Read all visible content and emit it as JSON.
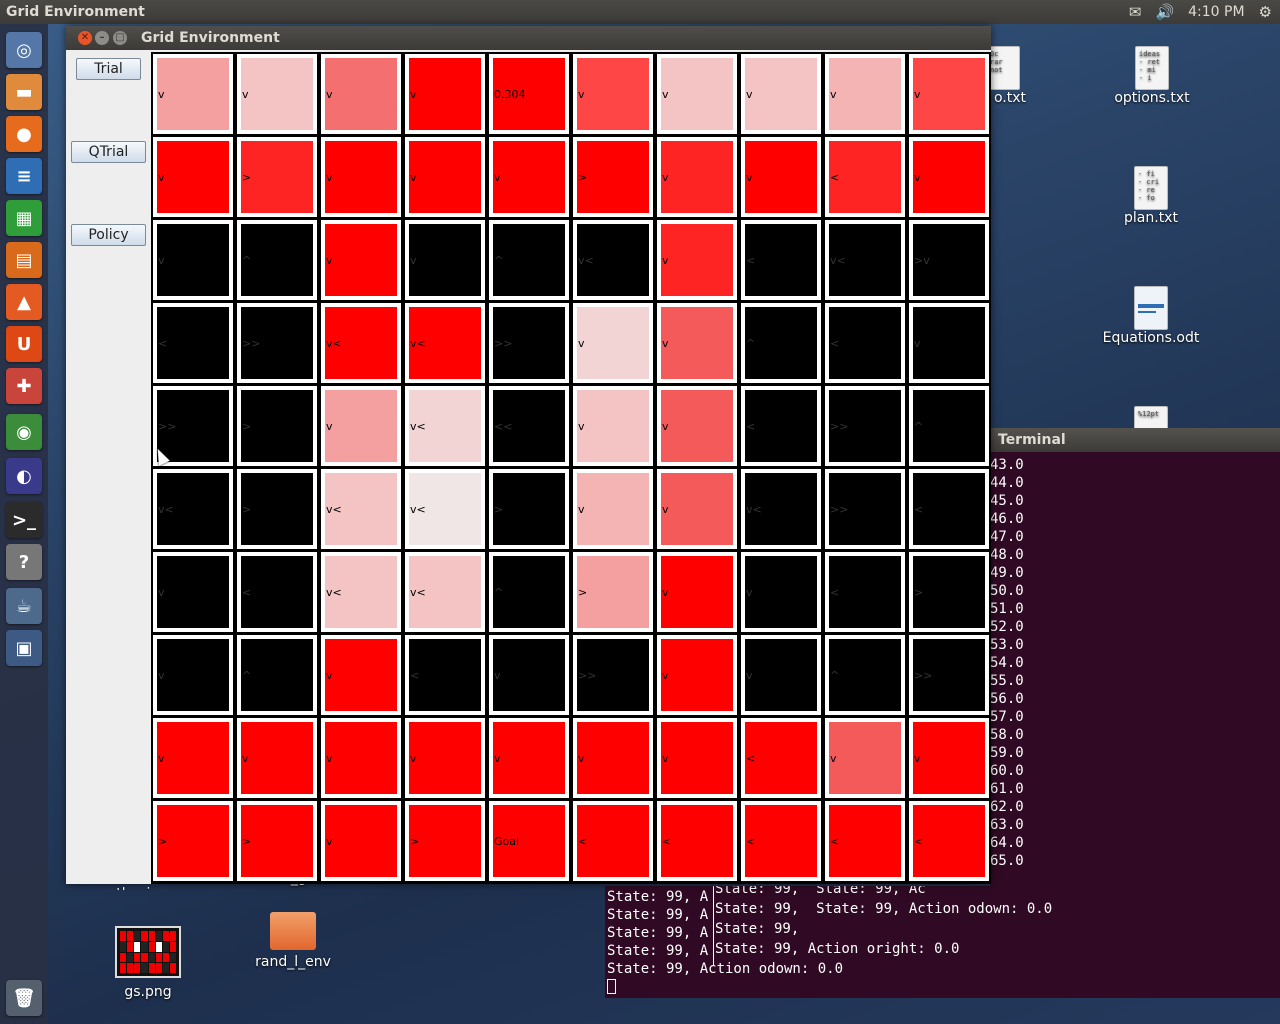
{
  "topbar": {
    "app_title": "Grid Environment",
    "time": "4:10 PM",
    "icons": [
      "mail-icon",
      "volume-icon",
      "gear-icon"
    ]
  },
  "launcher": {
    "items": [
      {
        "name": "dash-icon",
        "glyph": "◎",
        "color": "#5477a8"
      },
      {
        "name": "files-icon",
        "glyph": "▬",
        "color": "#e08a3b"
      },
      {
        "name": "firefox-icon",
        "glyph": "●",
        "color": "#e76b1c"
      },
      {
        "name": "writer-icon",
        "glyph": "≡",
        "color": "#2f6db5"
      },
      {
        "name": "calc-icon",
        "glyph": "▦",
        "color": "#2e9d3a"
      },
      {
        "name": "impress-icon",
        "glyph": "▤",
        "color": "#d96a1b"
      },
      {
        "name": "software-center-icon",
        "glyph": "▲",
        "color": "#e35b23"
      },
      {
        "name": "ubuntu-one-icon",
        "glyph": "U",
        "color": "#dd4814"
      },
      {
        "name": "settings-icon",
        "glyph": "✚",
        "color": "#c9443b"
      },
      {
        "name": "chrome-icon",
        "glyph": "◉",
        "color": "#3b8c3b"
      },
      {
        "name": "eclipse-icon",
        "glyph": "◐",
        "color": "#3a3a8a"
      },
      {
        "name": "terminal-icon",
        "glyph": ">_",
        "color": "#2b2b2b"
      },
      {
        "name": "help-icon",
        "glyph": "?",
        "color": "#777777"
      },
      {
        "name": "java-icon",
        "glyph": "☕",
        "color": "#4d6a8c"
      },
      {
        "name": "workspace-icon",
        "glyph": "▣",
        "color": "#3d5a85"
      },
      {
        "name": "trash-icon",
        "glyph": "🗑",
        "color": "#55606e"
      }
    ]
  },
  "desktop": {
    "files": [
      {
        "label": "options.txt",
        "preview": "ideas\n- ret\n- mi\n- i"
      },
      {
        "label": "plan.txt",
        "preview": "- fi\n- cri\n- re\n- fo"
      },
      {
        "label": "Equations.odt",
        "preview": ""
      },
      {
        "label": "o.txt",
        "preview": "Dc\nrar\nnot"
      },
      {
        "label": "gs.png",
        "preview": ""
      },
      {
        "label": "rand_l_env",
        "preview": ""
      },
      {
        "label": "masters thesis",
        "preview": ""
      },
      {
        "label": "rand_grid",
        "preview": ""
      }
    ]
  },
  "terminal": {
    "title": "Terminal",
    "lines": [
      "43.0",
      "44.0",
      "45.0",
      "46.0",
      "47.0",
      "48.0",
      "49.0",
      "50.0",
      "51.0",
      "52.0",
      "53.0",
      "54.0",
      "55.0",
      "56.0",
      "57.0",
      "58.0",
      "59.0",
      "60.0",
      "61.0",
      "62.0",
      "63.0",
      "64.0",
      "65.0"
    ],
    "bottom_left": [
      "State: 99, A",
      "State: 99, A",
      "State: 99, A",
      "State: 99, A",
      "State: 99, Action odown: 0.0"
    ],
    "bottom_right": [
      "State: 99,  State: 99, Ac",
      "State: 99,  State: 99, Action odown: 0.0",
      "State: 99, ",
      "State: 99, Action oright: 0.0"
    ]
  },
  "window": {
    "title": "Grid Environment",
    "buttons": {
      "trial": "Trial",
      "qtrial": "QTrial",
      "policy": "Policy"
    }
  },
  "colors": {
    "black": "#000000",
    "c0": "#ff0000",
    "c1": "#ff2424",
    "c2": "#ff4646",
    "c3": "#f45a5a",
    "c4": "#f47070",
    "c5": "#f4a0a0",
    "c6": "#f4b4b4",
    "c7": "#f4c4c4",
    "c8": "#f2d4d4",
    "c9": "#f0e6e6"
  },
  "grid": {
    "rows": [
      [
        {
          "c": "c5",
          "t": "v"
        },
        {
          "c": "c7",
          "t": "v"
        },
        {
          "c": "c4",
          "t": "v"
        },
        {
          "c": "c0",
          "t": "v"
        },
        {
          "c": "c0",
          "t": "0.304"
        },
        {
          "c": "c2",
          "t": "v"
        },
        {
          "c": "c7",
          "t": "v"
        },
        {
          "c": "c7",
          "t": "v"
        },
        {
          "c": "c6",
          "t": "v"
        },
        {
          "c": "c2",
          "t": "v"
        }
      ],
      [
        {
          "c": "c0",
          "t": "v"
        },
        {
          "c": "c1",
          "t": ">"
        },
        {
          "c": "c0",
          "t": "v"
        },
        {
          "c": "c0",
          "t": "v"
        },
        {
          "c": "c0",
          "t": "v"
        },
        {
          "c": "c0",
          "t": ">"
        },
        {
          "c": "c1",
          "t": "v"
        },
        {
          "c": "c0",
          "t": "v"
        },
        {
          "c": "c1",
          "t": "<"
        },
        {
          "c": "c0",
          "t": "v"
        }
      ],
      [
        {
          "c": "black",
          "t": "v"
        },
        {
          "c": "black",
          "t": "^"
        },
        {
          "c": "c0",
          "t": "v"
        },
        {
          "c": "black",
          "t": "v"
        },
        {
          "c": "black",
          "t": "^"
        },
        {
          "c": "black",
          "t": "v<"
        },
        {
          "c": "c1",
          "t": "v"
        },
        {
          "c": "black",
          "t": "<"
        },
        {
          "c": "black",
          "t": "v<"
        },
        {
          "c": "black",
          "t": ">v"
        }
      ],
      [
        {
          "c": "black",
          "t": "<"
        },
        {
          "c": "black",
          "t": ">>"
        },
        {
          "c": "c0",
          "t": "v<"
        },
        {
          "c": "c0",
          "t": "v<"
        },
        {
          "c": "black",
          "t": ">>"
        },
        {
          "c": "c8",
          "t": "v"
        },
        {
          "c": "c3",
          "t": "v"
        },
        {
          "c": "black",
          "t": "^"
        },
        {
          "c": "black",
          "t": "<"
        },
        {
          "c": "black",
          "t": "v"
        }
      ],
      [
        {
          "c": "black",
          "t": ">>"
        },
        {
          "c": "black",
          "t": ">"
        },
        {
          "c": "c5",
          "t": "v"
        },
        {
          "c": "c8",
          "t": "v<"
        },
        {
          "c": "black",
          "t": "<<"
        },
        {
          "c": "c7",
          "t": "v"
        },
        {
          "c": "c3",
          "t": "v"
        },
        {
          "c": "black",
          "t": "<"
        },
        {
          "c": "black",
          "t": ">>"
        },
        {
          "c": "black",
          "t": "^"
        }
      ],
      [
        {
          "c": "black",
          "t": "v<"
        },
        {
          "c": "black",
          "t": ">"
        },
        {
          "c": "c7",
          "t": "v<"
        },
        {
          "c": "c9",
          "t": "v<"
        },
        {
          "c": "black",
          "t": ">"
        },
        {
          "c": "c6",
          "t": "v"
        },
        {
          "c": "c3",
          "t": "v"
        },
        {
          "c": "black",
          "t": "v<"
        },
        {
          "c": "black",
          "t": ">>"
        },
        {
          "c": "black",
          "t": "<"
        }
      ],
      [
        {
          "c": "black",
          "t": "v"
        },
        {
          "c": "black",
          "t": "<"
        },
        {
          "c": "c7",
          "t": "v<"
        },
        {
          "c": "c7",
          "t": "v<"
        },
        {
          "c": "black",
          "t": "^"
        },
        {
          "c": "c5",
          "t": ">"
        },
        {
          "c": "c0",
          "t": "v"
        },
        {
          "c": "black",
          "t": "v"
        },
        {
          "c": "black",
          "t": "<"
        },
        {
          "c": "black",
          "t": ">"
        }
      ],
      [
        {
          "c": "black",
          "t": "v"
        },
        {
          "c": "black",
          "t": "^"
        },
        {
          "c": "c0",
          "t": "v"
        },
        {
          "c": "black",
          "t": "<"
        },
        {
          "c": "black",
          "t": "v"
        },
        {
          "c": "black",
          "t": ">>"
        },
        {
          "c": "c0",
          "t": "v"
        },
        {
          "c": "black",
          "t": "v"
        },
        {
          "c": "black",
          "t": "^"
        },
        {
          "c": "black",
          "t": ">>"
        }
      ],
      [
        {
          "c": "c0",
          "t": "v"
        },
        {
          "c": "c0",
          "t": "v"
        },
        {
          "c": "c0",
          "t": "v"
        },
        {
          "c": "c0",
          "t": "v"
        },
        {
          "c": "c0",
          "t": "v"
        },
        {
          "c": "c0",
          "t": "v"
        },
        {
          "c": "c0",
          "t": "v"
        },
        {
          "c": "c0",
          "t": "<"
        },
        {
          "c": "c3",
          "t": "v"
        },
        {
          "c": "c0",
          "t": "v"
        }
      ],
      [
        {
          "c": "c0",
          "t": ">"
        },
        {
          "c": "c0",
          "t": ">"
        },
        {
          "c": "c0",
          "t": "v"
        },
        {
          "c": "c0",
          "t": ">"
        },
        {
          "c": "c0",
          "t": "Goal"
        },
        {
          "c": "c0",
          "t": "<"
        },
        {
          "c": "c0",
          "t": "<"
        },
        {
          "c": "c0",
          "t": "<"
        },
        {
          "c": "c0",
          "t": "<"
        },
        {
          "c": "c0",
          "t": "<"
        }
      ]
    ]
  }
}
